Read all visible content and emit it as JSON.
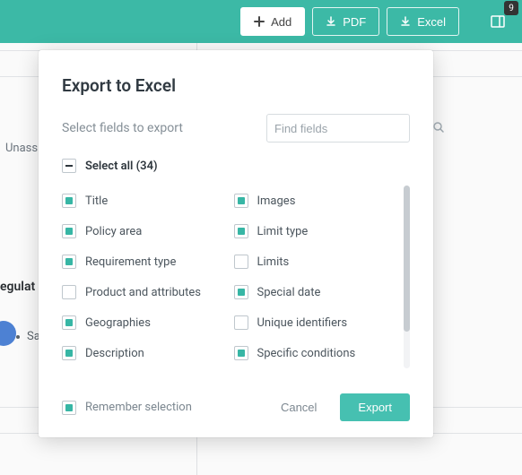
{
  "toolbar": {
    "add_label": "Add",
    "pdf_label": "PDF",
    "excel_label": "Excel",
    "badge_count": "9"
  },
  "background": {
    "unassigned": "Unass",
    "regulat": "egulat",
    "sara": "Sara"
  },
  "modal": {
    "title": "Export to Excel",
    "subtitle": "Select fields to export",
    "search_placeholder": "Find fields",
    "select_all": "Select all (34)",
    "fields_col1": [
      {
        "label": "Title",
        "checked": true
      },
      {
        "label": "Policy area",
        "checked": true
      },
      {
        "label": "Requirement type",
        "checked": true
      },
      {
        "label": "Product and attributes",
        "checked": false
      },
      {
        "label": "Geographies",
        "checked": true
      },
      {
        "label": "Description",
        "checked": true
      }
    ],
    "fields_col2": [
      {
        "label": "Images",
        "checked": true
      },
      {
        "label": "Limit type",
        "checked": true
      },
      {
        "label": "Limits",
        "checked": false
      },
      {
        "label": "Special date",
        "checked": true
      },
      {
        "label": "Unique identifiers",
        "checked": false
      },
      {
        "label": "Specific conditions",
        "checked": true
      }
    ],
    "remember_label": "Remember selection",
    "cancel_label": "Cancel",
    "export_label": "Export"
  }
}
